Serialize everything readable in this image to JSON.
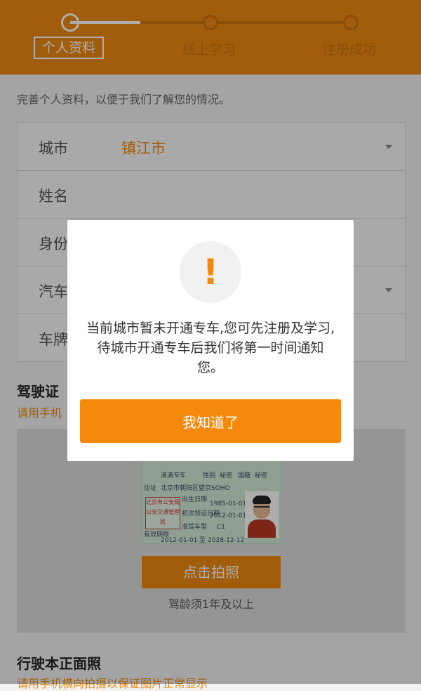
{
  "stepper": {
    "steps": [
      {
        "label": "个人资料",
        "active": true
      },
      {
        "label": "线上学习",
        "active": false
      },
      {
        "label": "注册成功",
        "active": false
      }
    ]
  },
  "subtitle": "完善个人资料，以便于我们了解您的情况。",
  "form": {
    "rows": [
      {
        "label": "城市",
        "value": "镇江市",
        "dropdown": true
      },
      {
        "label": "姓名",
        "value": "",
        "dropdown": false
      },
      {
        "label": "身份",
        "value": "",
        "dropdown": false
      },
      {
        "label": "汽车",
        "value": "",
        "dropdown": true
      },
      {
        "label": "车牌",
        "value": "",
        "dropdown": false
      }
    ]
  },
  "license_section": {
    "title": "驾驶证",
    "hint": "请用手机"
  },
  "sample_card": {
    "name": "滴滴专车",
    "sex_label": "性别",
    "sex": "秘密",
    "nationality_label": "国籍",
    "nationality": "秘密",
    "address_label": "住址",
    "address": "北京市朝阳区望京SOHO",
    "birth_label": "出生日期",
    "birth": "1985-01-01",
    "first_issue_label": "初次领证日期",
    "first_issue": "2012-01-01",
    "class_label": "准驾车型",
    "class": "C1",
    "validity_label": "有效期限",
    "validity": "2012-01-01 至 2028-12-12",
    "seal": "北京市公安局公安交通管理局"
  },
  "photo_button": "点击拍照",
  "photo_note": "驾龄须1年及以上",
  "registration_section": {
    "title": "行驶本正面照",
    "hint": "请用手机横向拍摄以保证图片正常显示"
  },
  "dialog": {
    "icon": "exclamation-icon",
    "message": "当前城市暂未开通专车,您可先注册及学习,待城市开通专车后我们将第一时间通知您。",
    "button": "我知道了"
  },
  "colors": {
    "brand_orange": "#ee8a12",
    "button_orange": "#f5890b"
  }
}
